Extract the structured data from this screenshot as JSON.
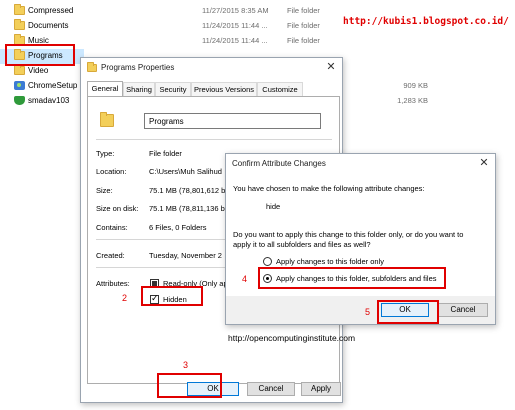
{
  "explorer": {
    "files": [
      {
        "name": "Compressed",
        "date": "11/27/2015 8:35 AM",
        "type": "File folder",
        "size": "",
        "icon": "folder-icon"
      },
      {
        "name": "Documents",
        "date": "11/24/2015 11:44 ...",
        "type": "File folder",
        "size": "",
        "icon": "folder-icon"
      },
      {
        "name": "Music",
        "date": "11/24/2015 11:44 ...",
        "type": "File folder",
        "size": "",
        "icon": "folder-icon"
      },
      {
        "name": "Programs",
        "date": "",
        "type": "",
        "size": "",
        "icon": "folder-icon"
      },
      {
        "name": "Video",
        "date": "",
        "type": "",
        "size": "",
        "icon": "folder-icon"
      },
      {
        "name": "ChromeSetup",
        "date": "",
        "type": "",
        "size": "909 KB",
        "icon": "chrome-setup-icon"
      },
      {
        "name": "smadav103",
        "date": "",
        "type": "",
        "size": "1,283 KB",
        "icon": "smadav-shield-icon"
      }
    ]
  },
  "watermark": "http://kubis1.blogspot.co.id/",
  "url_caption": "http://opencomputinginstitute.com",
  "annotations": {
    "n2": "2",
    "n3": "3",
    "n4": "4",
    "n5": "5"
  },
  "properties": {
    "title": "Programs Properties",
    "close": "✕",
    "tabs": [
      "General",
      "Sharing",
      "Security",
      "Previous Versions",
      "Customize"
    ],
    "folder_name": "Programs",
    "rows": [
      {
        "label": "Type:",
        "value": "File folder"
      },
      {
        "label": "Location:",
        "value": "C:\\Users\\Muh Salihud"
      },
      {
        "label": "Size:",
        "value": "75.1 MB (78,801,612 b"
      },
      {
        "label": "Size on disk:",
        "value": "75.1 MB (78,811,136 b"
      },
      {
        "label": "Contains:",
        "value": "6 Files, 0 Folders"
      },
      {
        "label": "Created:",
        "value": "Tuesday, November 2"
      }
    ],
    "attributes_label": "Attributes:",
    "readonly_label": "Read-only (Only ap",
    "hidden_label": "Hidden",
    "buttons": {
      "ok": "OK",
      "cancel": "Cancel",
      "apply": "Apply"
    }
  },
  "confirm": {
    "title": "Confirm Attribute Changes",
    "close": "✕",
    "line1": "You have chosen to make the following attribute changes:",
    "change": "hide",
    "question1": "Do you want to apply this change to this folder only, or do you want to",
    "question2": "apply it to all subfolders and files as well?",
    "option1": "Apply changes to this folder only",
    "option2": "Apply changes to this folder, subfolders and files",
    "ok": "OK",
    "cancel": "Cancel"
  }
}
